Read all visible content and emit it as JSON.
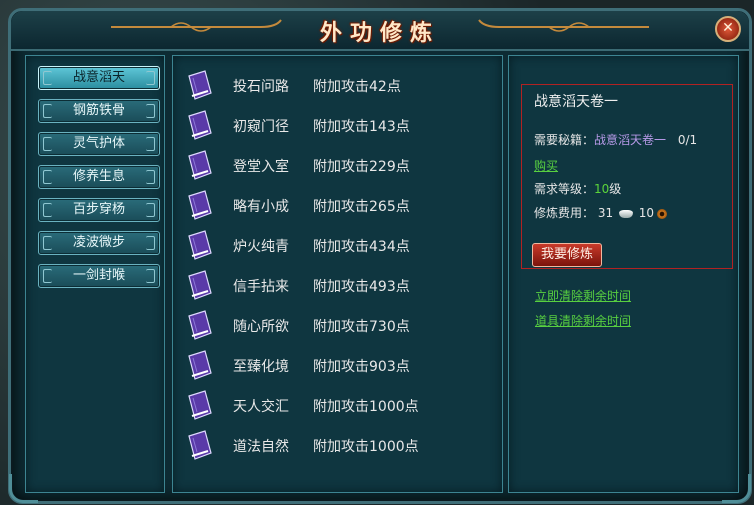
{
  "window": {
    "title": "外功修炼",
    "close_label": "✕"
  },
  "tabs": [
    {
      "label": "战意滔天",
      "active": true
    },
    {
      "label": "钢筋铁骨",
      "active": false
    },
    {
      "label": "灵气护体",
      "active": false
    },
    {
      "label": "修养生息",
      "active": false
    },
    {
      "label": "百步穿杨",
      "active": false
    },
    {
      "label": "凌波微步",
      "active": false
    },
    {
      "label": "一剑封喉",
      "active": false
    }
  ],
  "skills": [
    {
      "name": "投石问路",
      "bonus": "附加攻击42点"
    },
    {
      "name": "初窥门径",
      "bonus": "附加攻击143点"
    },
    {
      "name": "登堂入室",
      "bonus": "附加攻击229点"
    },
    {
      "name": "略有小成",
      "bonus": "附加攻击265点"
    },
    {
      "name": "炉火纯青",
      "bonus": "附加攻击434点"
    },
    {
      "name": "信手拈来",
      "bonus": "附加攻击493点"
    },
    {
      "name": "随心所欲",
      "bonus": "附加攻击730点"
    },
    {
      "name": "至臻化境",
      "bonus": "附加攻击903点"
    },
    {
      "name": "天人交汇",
      "bonus": "附加攻击1000点"
    },
    {
      "name": "道法自然",
      "bonus": "附加攻击1000点"
    }
  ],
  "detail": {
    "title": "战意滔天卷一",
    "required_book_label": "需要秘籍：",
    "required_book": "战意滔天卷一",
    "required_book_count": "0/1",
    "buy_label": "购买",
    "level_label": "需求等级：",
    "level_value": "10",
    "level_unit": "级",
    "cost_label": "修炼费用：",
    "cost_silver": "31",
    "cost_copper": "10",
    "train_button": "我要修炼"
  },
  "links": {
    "clear_now": "立即清除剩余时间",
    "clear_item": "道具清除剩余时间"
  },
  "colors": {
    "frame": "#3f6e78",
    "panel_bg": "#0f3640",
    "detail_border": "#b22222",
    "link_green": "#58d040",
    "book_violet": "#b79ae8"
  },
  "icons": {
    "book": "book-icon",
    "silver": "silver-ingot-icon",
    "copper": "copper-coin-icon"
  }
}
